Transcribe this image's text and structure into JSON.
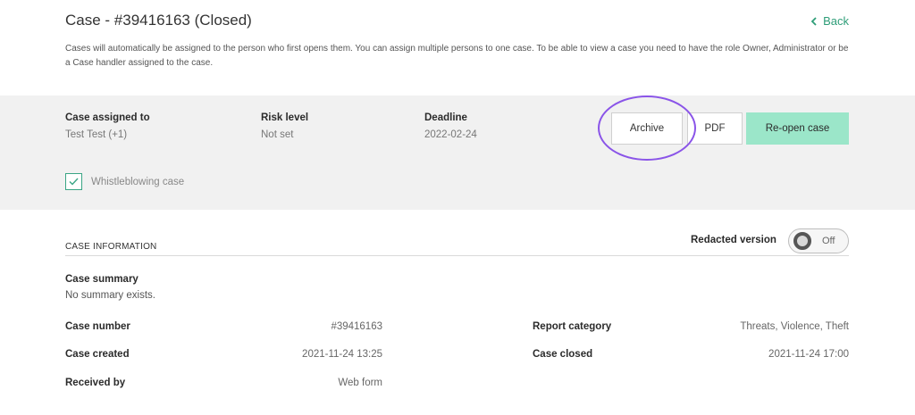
{
  "header": {
    "title": "Case - #39416163 (Closed)",
    "back_label": "Back",
    "description": "Cases will automatically be assigned to the person who first opens them. You can assign multiple persons to one case. To be able to view a case you need to have the role Owner, Administrator or be a Case handler assigned to the case."
  },
  "summary": {
    "assigned_label": "Case assigned to",
    "assigned_value": "Test Test (+1)",
    "risk_label": "Risk level",
    "risk_value": "Not set",
    "deadline_label": "Deadline",
    "deadline_value": "2022-02-24",
    "archive_label": "Archive",
    "pdf_label": "PDF",
    "reopen_label": "Re-open case",
    "whistleblowing_label": "Whistleblowing case",
    "whistleblowing_checked": true
  },
  "info": {
    "section_title": "CASE INFORMATION",
    "redacted_label": "Redacted version",
    "redacted_toggle": "Off",
    "case_summary_label": "Case summary",
    "case_summary_value": "No summary exists.",
    "left_rows": [
      {
        "label": "Case number",
        "value": "#39416163"
      },
      {
        "label": "Case created",
        "value": "2021-11-24 13:25"
      },
      {
        "label": "Received by",
        "value": "Web form"
      }
    ],
    "right_rows": [
      {
        "label": "Report category",
        "value": "Threats, Violence, Theft"
      },
      {
        "label": "Case closed",
        "value": "2021-11-24 17:00"
      }
    ]
  },
  "colors": {
    "accent_green": "#9be6c9",
    "link_green": "#2e9d78",
    "highlight_purple": "#8a54e8"
  }
}
